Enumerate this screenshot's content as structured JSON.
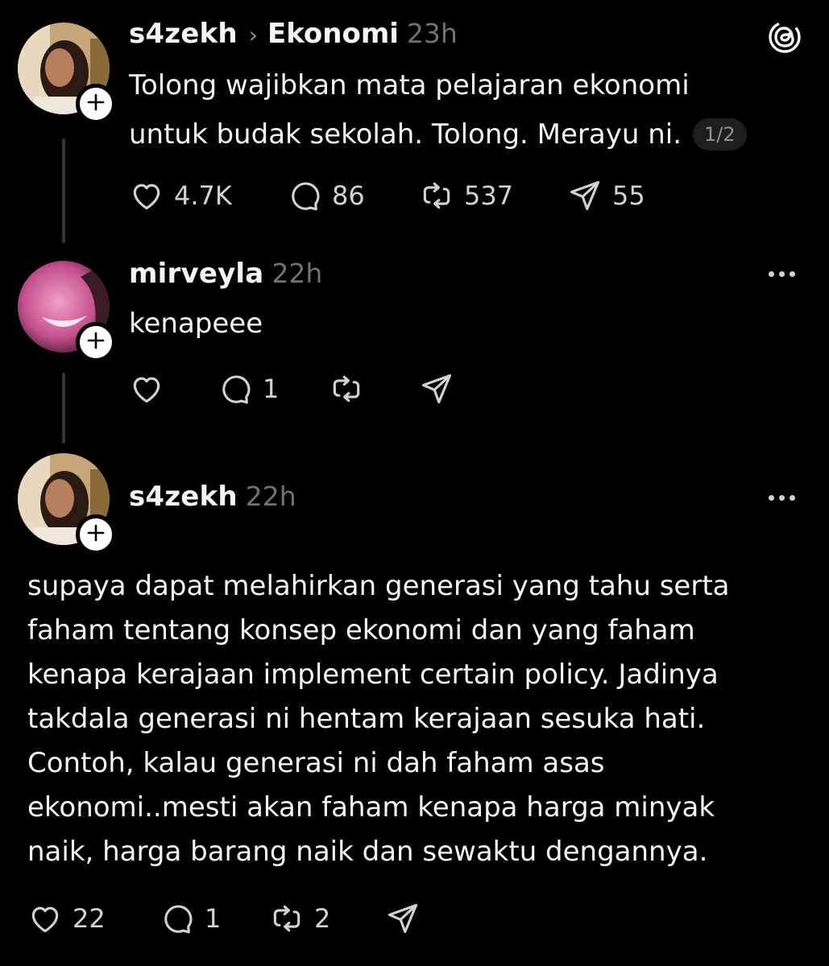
{
  "threads_logo_icon": "threads-logo-icon",
  "posts": [
    {
      "username": "s4zekh",
      "topic": "Ekonomi",
      "topic_separator": "›",
      "time": "23h",
      "lines": [
        "Tolong wajibkan mata pelajaran ekonomi",
        "untuk budak sekolah. Tolong. Merayu ni."
      ],
      "page_indicator": "1/2",
      "likes": "4.7K",
      "replies": "86",
      "reposts": "537",
      "shares": "55"
    },
    {
      "username": "mirveyla",
      "time": "22h",
      "lines": [
        "kenapeee"
      ],
      "likes": "",
      "replies": "1",
      "reposts": "",
      "shares": ""
    },
    {
      "username": "s4zekh",
      "time": "22h",
      "lines": [
        "supaya dapat melahirkan generasi yang tahu serta",
        "faham tentang konsep ekonomi dan yang faham",
        "kenapa kerajaan implement certain policy. Jadinya",
        "takdala generasi ni hentam kerajaan sesuka hati.",
        "Contoh, kalau generasi ni dah faham asas",
        "ekonomi..mesti akan faham kenapa harga minyak",
        "naik, harga barang naik dan sewaktu dengannya."
      ],
      "likes": "22",
      "replies": "1",
      "reposts": "2",
      "shares": ""
    }
  ],
  "follow_symbol": "+",
  "colors": {
    "background": "#000000",
    "primary_text": "#f3f5f7",
    "secondary_text": "#6f7377",
    "thread_line": "#333638"
  }
}
